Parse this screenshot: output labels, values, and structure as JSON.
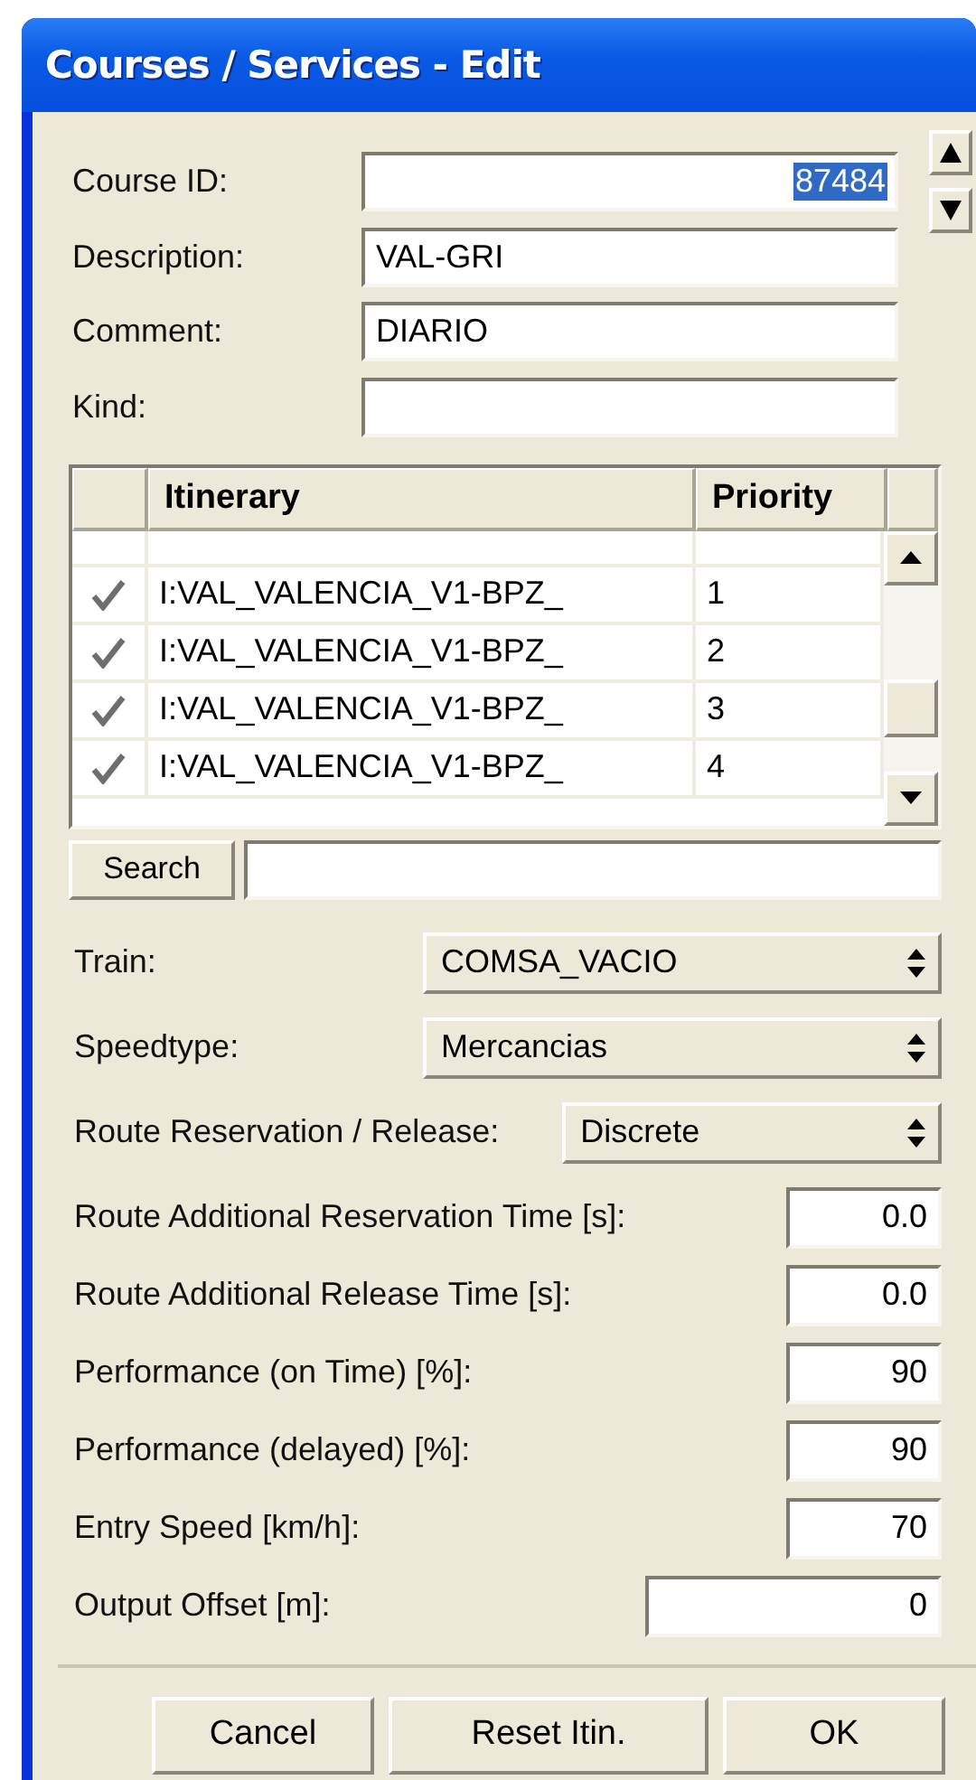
{
  "window": {
    "title": "Courses / Services - Edit"
  },
  "fields": [
    {
      "label": "Course ID:",
      "value": "87484",
      "selected": true
    },
    {
      "label": "Description:",
      "value": "VAL-GRI"
    },
    {
      "label": "Comment:",
      "value": "DIARIO"
    },
    {
      "label": "Kind:"
    }
  ],
  "table": {
    "columns": [
      "Itinerary",
      "Priority"
    ],
    "rows": [
      {
        "itinerary": "I:VAL_VALENCIA_V1-BPZ_",
        "priority": "1",
        "checked": true
      },
      {
        "itinerary": "I:VAL_VALENCIA_V1-BPZ_",
        "priority": "2",
        "checked": true
      },
      {
        "itinerary": "I:VAL_VALENCIA_V1-BPZ_",
        "priority": "3",
        "checked": true
      },
      {
        "itinerary": "I:VAL_VALENCIA_V1-BPZ_",
        "priority": "4",
        "checked": true
      }
    ]
  },
  "search": {
    "button": "Search"
  },
  "options": [
    {
      "kind": "select",
      "label": "Train:",
      "value": "COMSA_VACIO"
    },
    {
      "kind": "select",
      "label": "Speedtype:",
      "value": "Mercancias"
    },
    {
      "kind": "select",
      "label": "Route Reservation / Release:",
      "value": "Discrete"
    },
    {
      "kind": "number",
      "label": "Route Additional Reservation Time [s]:",
      "value": "0.0"
    },
    {
      "kind": "number",
      "label": "Route Additional Release Time [s]:",
      "value": "0.0"
    },
    {
      "kind": "number",
      "label": "Performance (on Time) [%]:",
      "value": "90"
    },
    {
      "kind": "number",
      "label": "Performance (delayed) [%]:",
      "value": "90"
    },
    {
      "kind": "number",
      "label": "Entry Speed [km/h]:",
      "value": "70"
    },
    {
      "kind": "longnumber",
      "label": "Output Offset [m]:",
      "value": "0"
    }
  ],
  "buttons": [
    "Cancel",
    "Reset Itin.",
    "OK"
  ]
}
